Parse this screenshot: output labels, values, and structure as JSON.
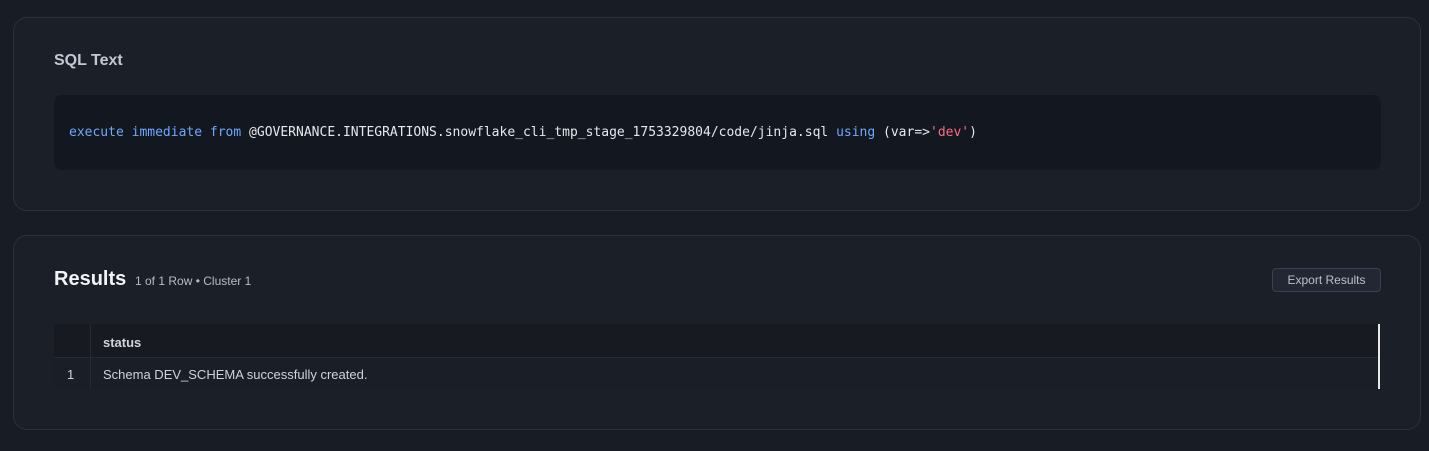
{
  "sql_section": {
    "title": "SQL Text",
    "code": {
      "kw_execute": "execute",
      "kw_immediate": "immediate",
      "kw_from": "from",
      "stage_path": "@GOVERNANCE.INTEGRATIONS.snowflake_cli_tmp_stage_1753329804/code/jinja.sql",
      "kw_using": "using",
      "args_open": "(var=>",
      "arg_value": "'dev'",
      "args_close": ")"
    }
  },
  "results_section": {
    "title": "Results",
    "meta": "1 of 1 Row • Cluster 1",
    "export_label": "Export Results",
    "columns": [
      "status"
    ],
    "rows": [
      {
        "num": "1",
        "status": "Schema DEV_SCHEMA successfully created."
      }
    ]
  },
  "colors": {
    "background": "#181c24",
    "card": "#1b1f28",
    "code_bg": "#121720",
    "keyword": "#6ea8fe",
    "string": "#ff6b81"
  }
}
